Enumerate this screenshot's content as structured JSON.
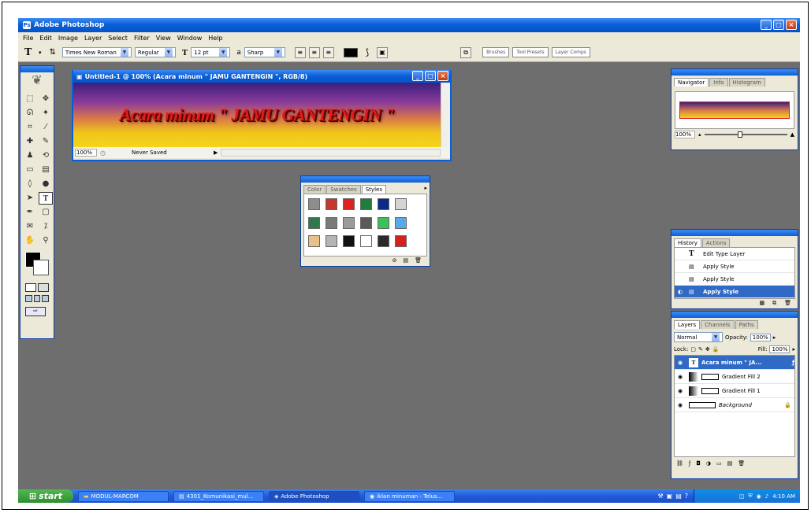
{
  "window": {
    "title": "Adobe Photoshop"
  },
  "menu": [
    "File",
    "Edit",
    "Image",
    "Layer",
    "Select",
    "Filter",
    "View",
    "Window",
    "Help"
  ],
  "options": {
    "tool_icon": "T",
    "font_family": "Times New Roman",
    "font_style": "Regular",
    "font_size": "12 pt",
    "aa_label": "a",
    "antialias": "Sharp",
    "wells": [
      "Brushes",
      "Tool Presets",
      "Layer Comps"
    ]
  },
  "document": {
    "title": "Untitled-1 @ 100% (Acara minum \" JAMU GANTENGIN \", RGB/8)",
    "canvas_text": "Acara minum \" JAMU GANTENGIN \"",
    "zoom": "100%",
    "status": "Never Saved"
  },
  "styles_panel": {
    "tabs": [
      "Color",
      "Swatches",
      "Styles"
    ],
    "active": "Styles",
    "swatches": [
      "#8d8d8d",
      "#c0392b",
      "#e02020",
      "#1e7f3c",
      "#0b2a8a",
      "#d4d4d4",
      "#2f7a4a",
      "#7a7a7a",
      "#9a9a9a",
      "#5a5a5a",
      "#3cc05a",
      "#5aa9e6",
      "#e8c08a",
      "#b5b5b5",
      "#111111",
      "#ffffff",
      "#2a2a2a",
      "#d42020"
    ]
  },
  "navigator": {
    "tabs": [
      "Navigator",
      "Info",
      "Histogram"
    ],
    "active": "Navigator",
    "zoom": "100%"
  },
  "history": {
    "tabs": [
      "History",
      "Actions"
    ],
    "active": "History",
    "items": [
      {
        "label": "Edit Type Layer",
        "icon": "T"
      },
      {
        "label": "Apply Style",
        "icon": "doc"
      },
      {
        "label": "Apply Style",
        "icon": "doc"
      },
      {
        "label": "Apply Style",
        "icon": "doc",
        "selected": true
      }
    ]
  },
  "layers": {
    "tabs": [
      "Layers",
      "Channels",
      "Paths"
    ],
    "active": "Layers",
    "blend_mode": "Normal",
    "opacity_label": "Opacity:",
    "opacity": "100%",
    "lock_label": "Lock:",
    "fill_label": "Fill:",
    "fill": "100%",
    "items": [
      {
        "name": "Acara minum \" JA...",
        "type": "text",
        "selected": true
      },
      {
        "name": "Gradient Fill 2",
        "type": "gradient"
      },
      {
        "name": "Gradient Fill 1",
        "type": "gradient"
      },
      {
        "name": "Background",
        "type": "bg"
      }
    ]
  },
  "taskbar": {
    "start": "start",
    "tasks": [
      {
        "label": "MODUL-MARCOM"
      },
      {
        "label": "4301_Komunikasi_mul..."
      },
      {
        "label": "Adobe Photoshop",
        "active": true
      },
      {
        "label": "iklan minuman - Telus..."
      }
    ],
    "clock": "4:10 AM"
  }
}
